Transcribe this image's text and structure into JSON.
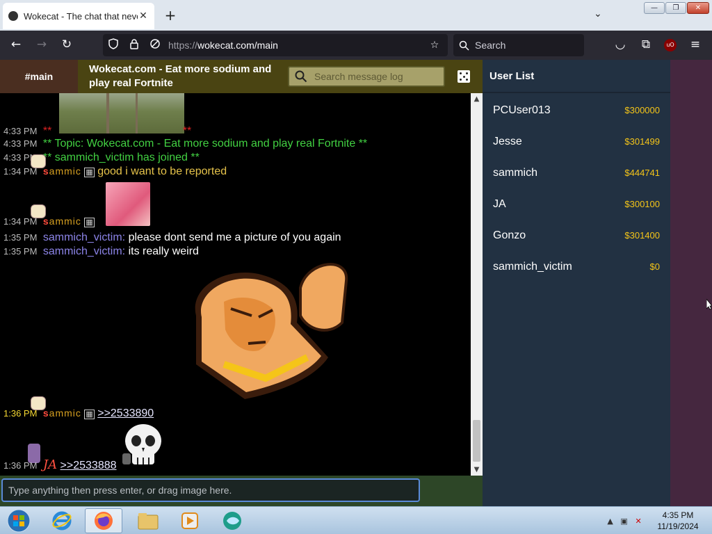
{
  "browser": {
    "tab_title": "Wokecat - The chat that never",
    "tab_close": "✕",
    "new_tab": "+",
    "tab_list": "⌄",
    "url_proto": "https://",
    "url_host": "wokecat.com/main",
    "search_placeholder": "Search",
    "ublock_label": "uO",
    "window_buttons": {
      "minimize": "—",
      "maximize": "❐",
      "close": "✕"
    },
    "nav_icons": {
      "back": "←",
      "forward": "→",
      "reload": "↻",
      "star": "☆",
      "pocket": "◡",
      "extensions": "⧉",
      "menu": "≡"
    }
  },
  "app": {
    "channel": "#main",
    "topic_title": "Wokecat.com - Eat more sodium and play real Fortnite",
    "search_placeholder": "Search message log",
    "input_placeholder": "Type anything then press enter, or drag image here.",
    "userlist_title": "User List",
    "messages": [
      {
        "time": "4:33 PM",
        "text": "** ",
        "tail": "**"
      },
      {
        "time": "4:33 PM",
        "text": "** Topic: Wokecat.com - Eat more sodium and play real Fortnite **"
      },
      {
        "time": "4:33 PM",
        "text": "** sammich_victim has joined **"
      },
      {
        "time": "1:34 PM",
        "nick": "sammich",
        "text": "good i want to be reported"
      },
      {
        "time": "1:34 PM",
        "nick": "sammich",
        "text": ""
      },
      {
        "time": "1:35 PM",
        "nick": "sammich_victim:",
        "text": "please dont send me a picture of you again"
      },
      {
        "time": "1:35 PM",
        "nick": "sammich_victim:",
        "text": "its really weird"
      },
      {
        "time": "1:36 PM",
        "nick": "sammich",
        "text": ">>2533890"
      },
      {
        "time": "1:36 PM",
        "nick": "JA",
        "text": ">>2533888"
      }
    ],
    "users": [
      {
        "name": "PCUser013",
        "balance": "$300000"
      },
      {
        "name": "Jesse",
        "balance": "$301499"
      },
      {
        "name": "sammich",
        "balance": "$444741"
      },
      {
        "name": "JA",
        "balance": "$300100"
      },
      {
        "name": "Gonzo",
        "balance": "$301400"
      },
      {
        "name": "sammich_victim",
        "balance": "$0"
      }
    ]
  },
  "taskbar": {
    "time": "4:35 PM",
    "date": "11/19/2024"
  }
}
